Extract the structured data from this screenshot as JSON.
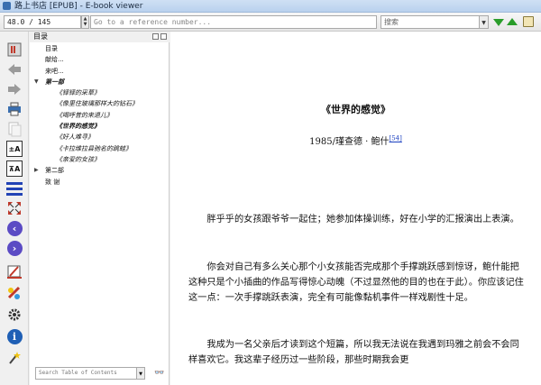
{
  "window": {
    "title": "路上书店 [EPUB] - E-book viewer"
  },
  "toolbar": {
    "page_value": "48.0 / 145",
    "reference_placeholder": "Go to a reference number...",
    "search_placeholder": "搜索"
  },
  "rail_icons": [
    "book-logo-icon",
    "back-arrow-icon",
    "forward-arrow-icon",
    "print-icon",
    "copy-icon",
    "font-larger-icon",
    "font-smaller-icon",
    "toc-lines-icon",
    "fullscreen-icon",
    "previous-page-icon",
    "next-page-icon",
    "bookmark-icon",
    "reference-mode-icon",
    "preferences-icon",
    "metadata-info-icon",
    "help-wand-icon"
  ],
  "toc": {
    "header": "目录",
    "items": [
      {
        "level": 0,
        "label": "目录",
        "expander": ""
      },
      {
        "level": 0,
        "label": "献给...",
        "expander": ""
      },
      {
        "level": 0,
        "label": "来吧...",
        "expander": ""
      },
      {
        "level": 0,
        "label": "第一部",
        "expander": "▼",
        "style": "italic bold"
      },
      {
        "level": 1,
        "label": "《铎铎的采草》",
        "style": "italic"
      },
      {
        "level": 1,
        "label": "《像里住玻璃那样大的钻石》",
        "style": "italic"
      },
      {
        "level": 1,
        "label": "《喝呼昔的来退儿》",
        "style": "italic"
      },
      {
        "level": 1,
        "label": "《世界的感觉》",
        "style": "italic bold"
      },
      {
        "level": 1,
        "label": "《好人难寻》",
        "style": "italic"
      },
      {
        "level": 1,
        "label": "《卡拉维拉县驰名的跳蛙》",
        "style": "italic"
      },
      {
        "level": 1,
        "label": "《亲爱的女孩》",
        "style": "italic"
      },
      {
        "level": 0,
        "label": "第二部",
        "expander": "▶"
      },
      {
        "level": 0,
        "label": "致 谢",
        "expander": ""
      }
    ],
    "search_placeholder": "Search Table of Contents"
  },
  "reader": {
    "chapter_title": "《世界的感觉》",
    "byline": "1985/瑾查德 · 鲍什",
    "footnote_ref": "[54]",
    "paragraphs": [
      "胖乎乎的女孩跟爷爷一起住；她参加体操训练，好在小学的汇报演出上表演。",
      "你会对自己有多么关心那个小女孩能否完成那个手撑跳跃感到惊讶，鲍什能把这种只是个小插曲的作品写得惊心动魄（不过显然他的目的也在于此）。你应该记住这一点：一次手撑跳跃表演，完全有可能像黏机事件一样戏剧性十足。",
      "我成为一名父亲后才读到这个短篇，所以我无法说在我遇到玛雅之前会不会同样喜欢它。我这辈子经历过一些阶段，那些时期我会更"
    ]
  }
}
